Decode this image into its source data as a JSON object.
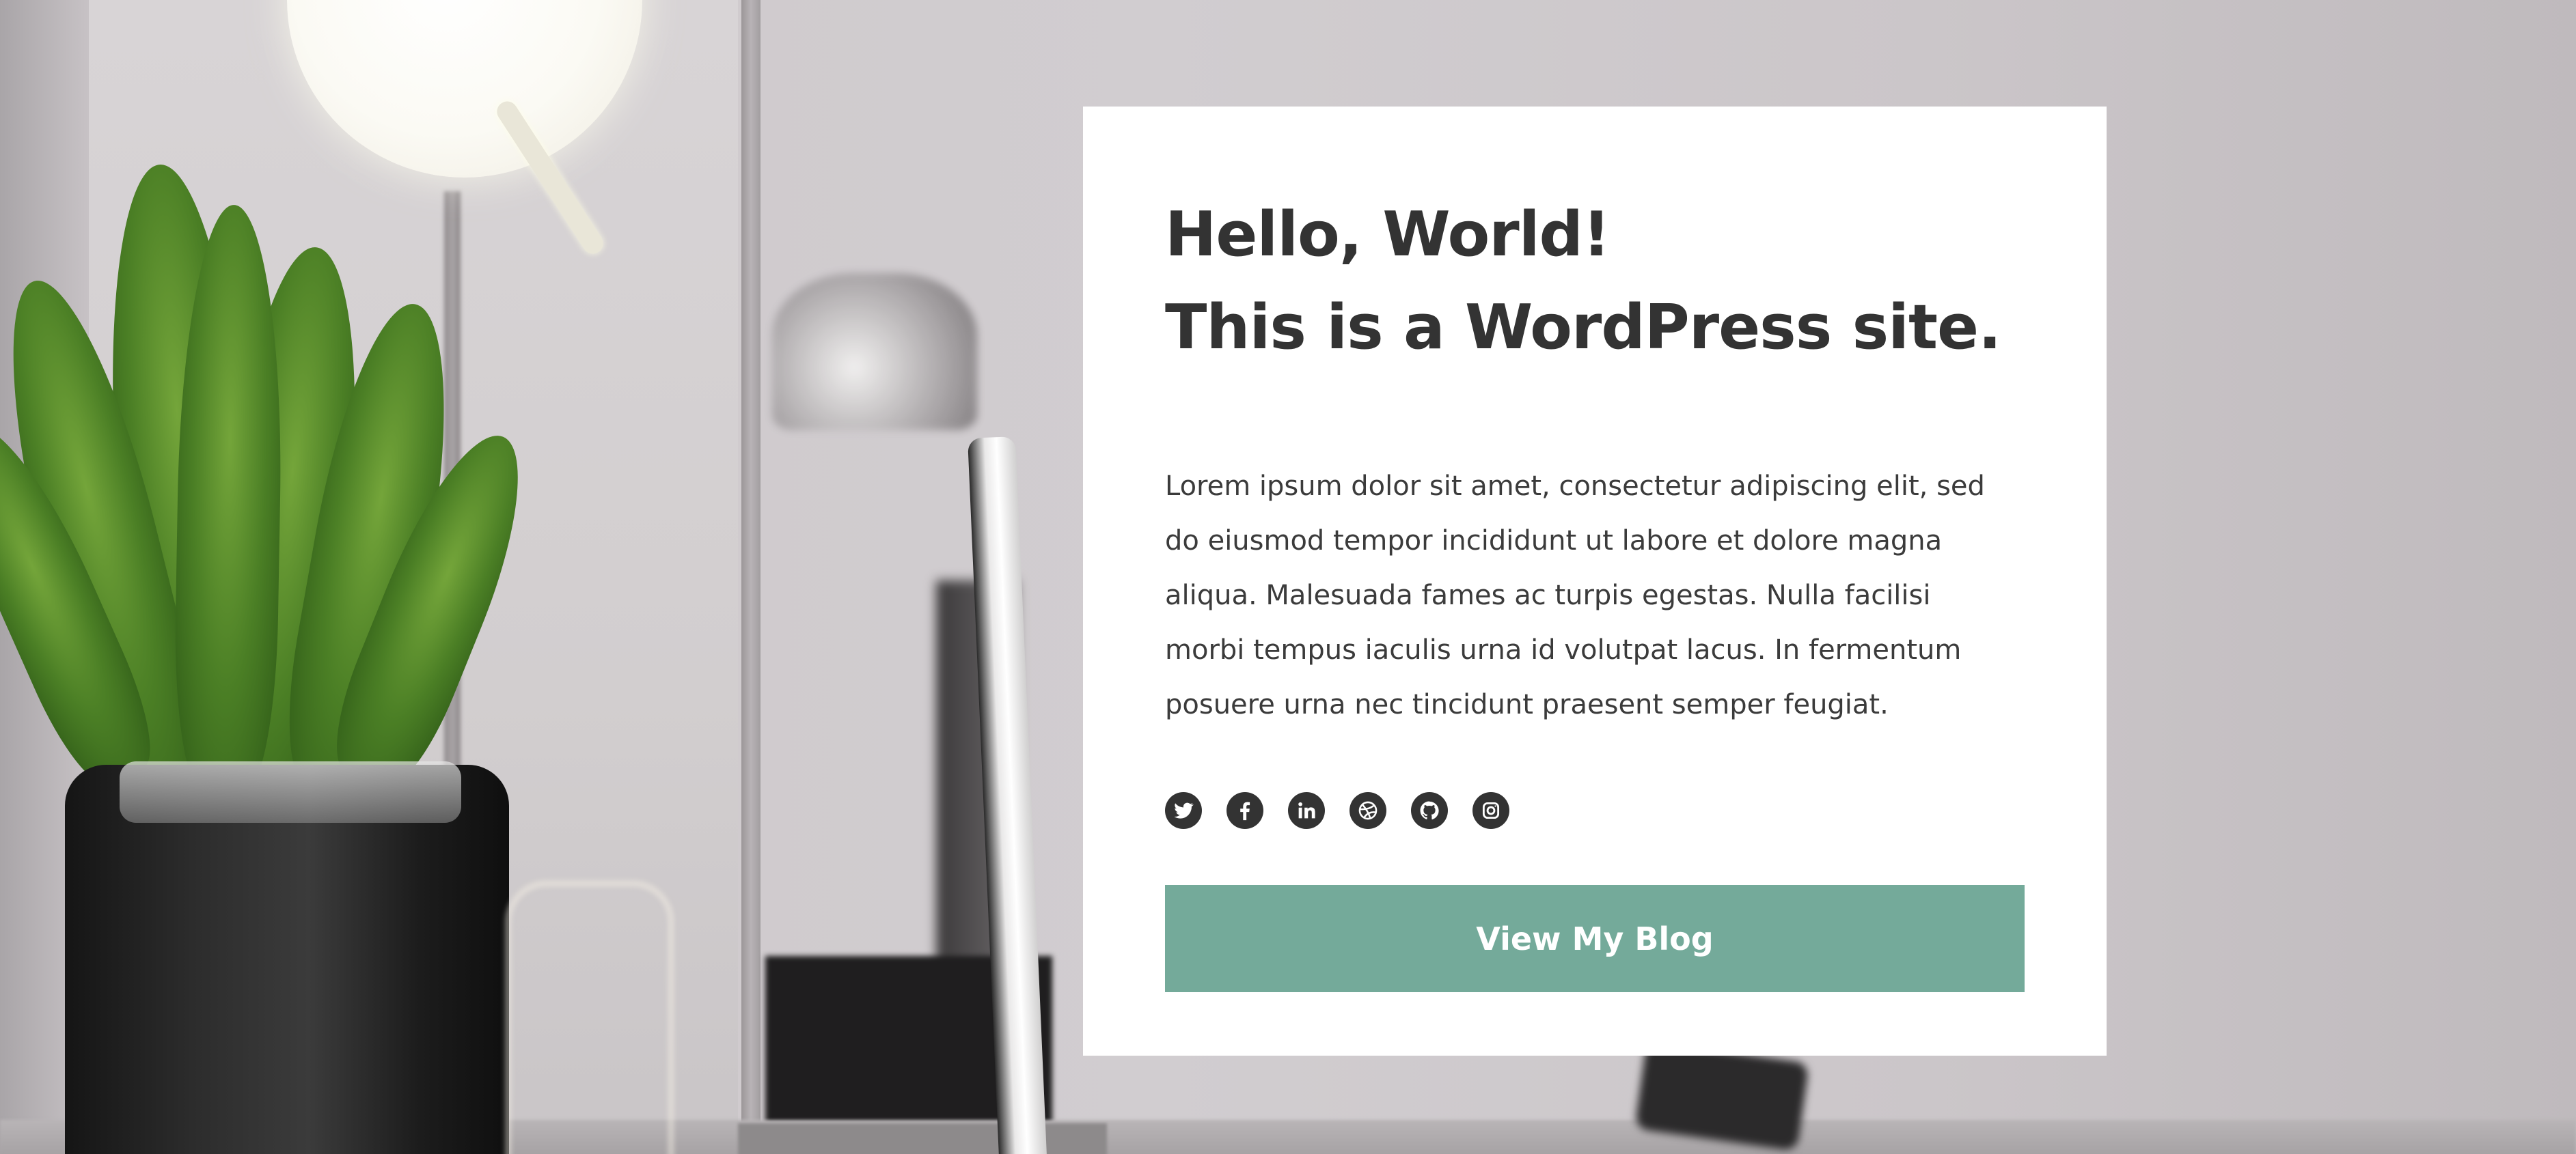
{
  "hero": {
    "title_line1": "Hello, World!",
    "title_line2": "This is a WordPress site.",
    "body": "Lorem ipsum dolor sit amet, consectetur adipiscing elit, sed do eiusmod tempor incididunt ut labore et dolore magna aliqua. Malesuada fames ac turpis egestas. Nulla facilisi morbi tempus iaculis urna id volutpat lacus. In fermentum posuere urna nec tincidunt praesent semper feugiat.",
    "cta_label": "View My Blog",
    "social_icons": [
      "twitter-icon",
      "facebook-icon",
      "linkedin-icon",
      "dribbble-icon",
      "github-icon",
      "instagram-icon"
    ]
  },
  "colors": {
    "card_background": "#ffffff",
    "heading_text": "#333333",
    "button_background": "#74aa9a",
    "button_text": "#ffffff"
  }
}
